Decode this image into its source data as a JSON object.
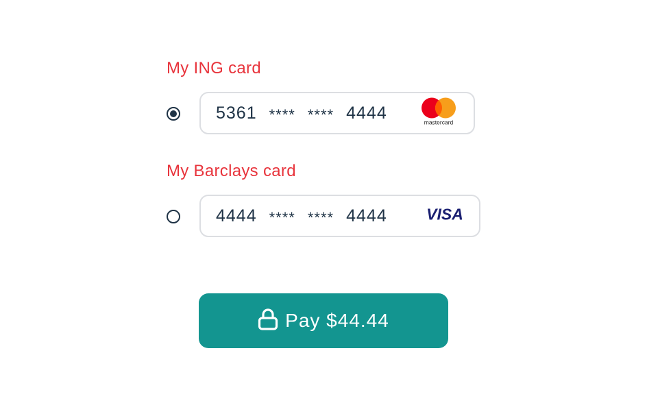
{
  "cards": [
    {
      "label": "My ING card",
      "selected": true,
      "first": "5361",
      "mask1": "****",
      "mask2": "****",
      "last": "4444",
      "brand": "mastercard",
      "brand_text": "mastercard"
    },
    {
      "label": "My Barclays card",
      "selected": false,
      "first": "4444",
      "mask1": "****",
      "mask2": "****",
      "last": "4444",
      "brand": "visa",
      "brand_text": "VISA"
    }
  ],
  "pay_button": {
    "label": "Pay $44.44",
    "icon": "lock-icon",
    "color": "#139590"
  },
  "colors": {
    "label": "#e8343c",
    "text": "#1f3346",
    "border": "#dcdee2",
    "visa": "#1a1f71"
  }
}
